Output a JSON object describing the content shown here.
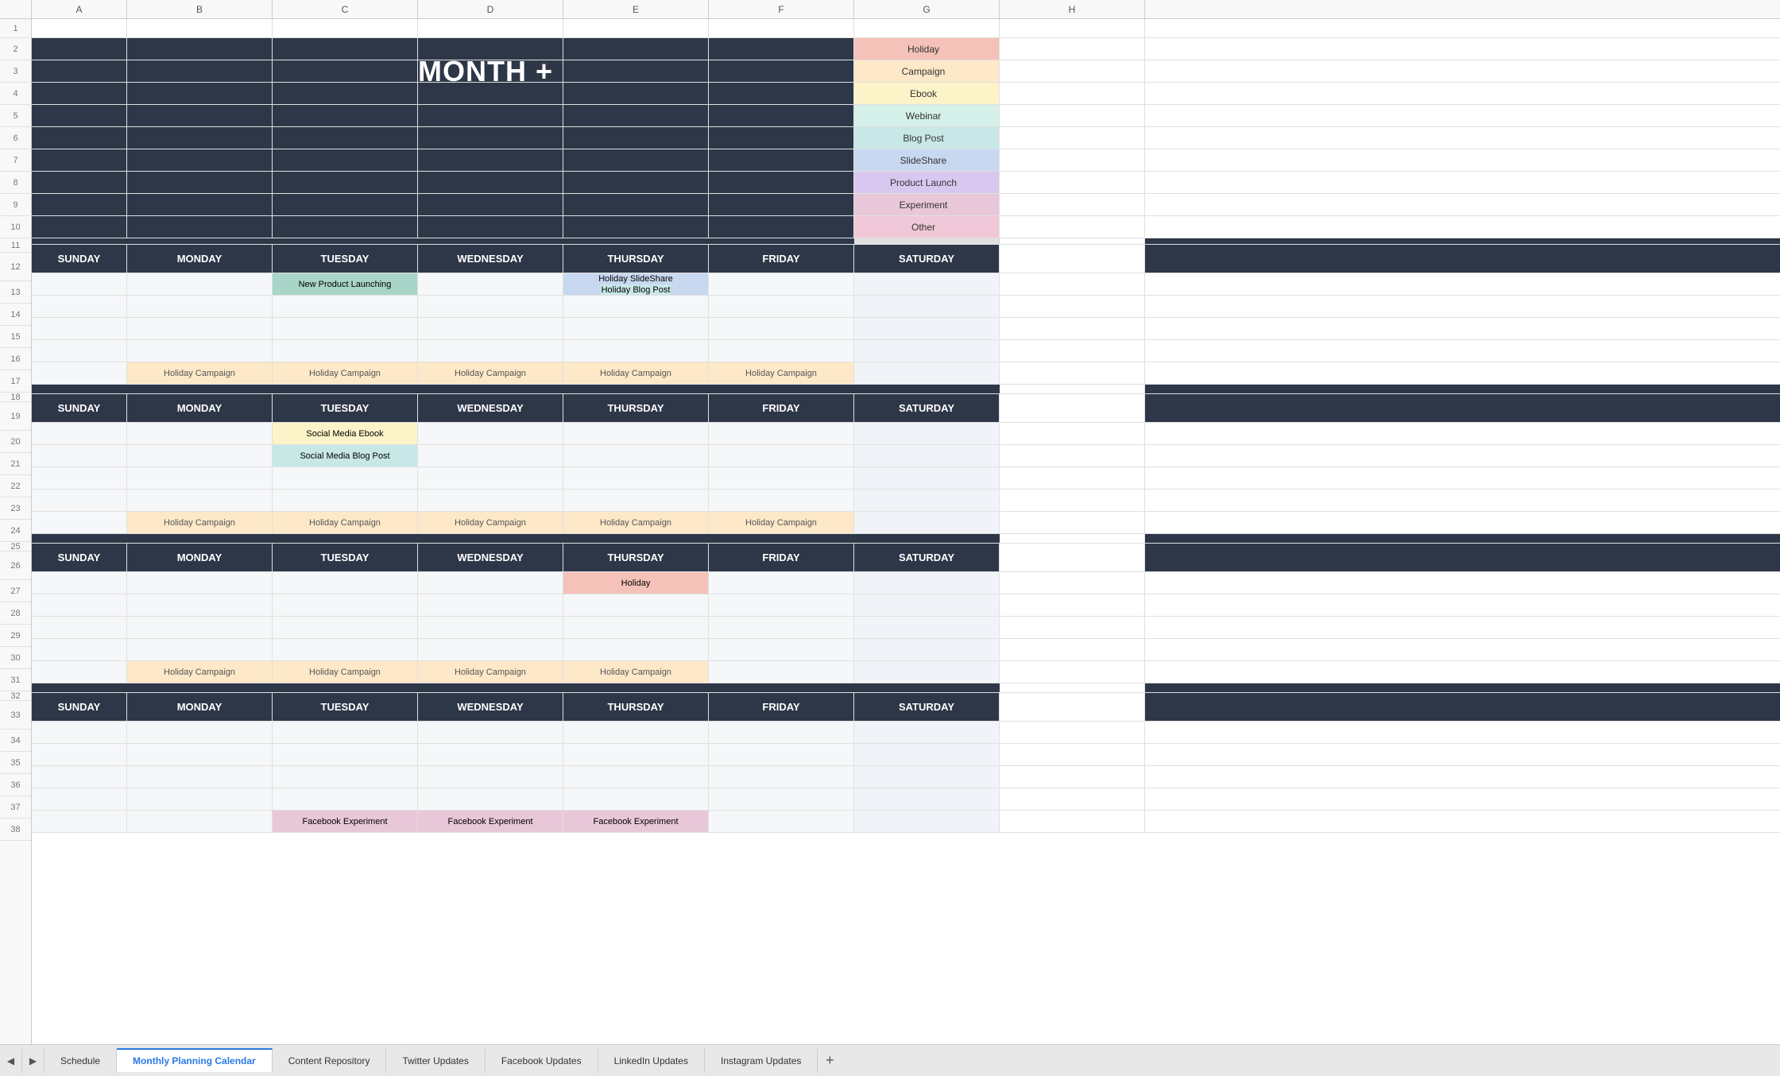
{
  "colHeaders": [
    "A",
    "B",
    "C",
    "D",
    "E",
    "F",
    "G",
    "H"
  ],
  "title": "[INSERT MONTH + YEAR]",
  "legend": {
    "items": [
      {
        "label": "Holiday",
        "colorClass": "legend-holiday"
      },
      {
        "label": "Campaign",
        "colorClass": "legend-campaign"
      },
      {
        "label": "Ebook",
        "colorClass": "legend-ebook"
      },
      {
        "label": "Webinar",
        "colorClass": "legend-webinar"
      },
      {
        "label": "Blog Post",
        "colorClass": "legend-blogpost"
      },
      {
        "label": "SlideShare",
        "colorClass": "legend-slideshare"
      },
      {
        "label": "Product Launch",
        "colorClass": "legend-productlaunch"
      },
      {
        "label": "Experiment",
        "colorClass": "legend-experiment"
      },
      {
        "label": "Other",
        "colorClass": "legend-other"
      }
    ]
  },
  "days": [
    "SUNDAY",
    "MONDAY",
    "TUESDAY",
    "WEDNESDAY",
    "THURSDAY",
    "FRIDAY",
    "SATURDAY"
  ],
  "week1": {
    "row13": {
      "tuesday": "New Product Launching",
      "thursday_top": "Holiday SlideShare",
      "thursday_bottom": "Holiday Blog Post"
    },
    "row17": {
      "monday": "Holiday Campaign",
      "tuesday": "Holiday Campaign",
      "wednesday": "Holiday Campaign",
      "thursday": "Holiday Campaign",
      "friday": "Holiday Campaign"
    }
  },
  "week2": {
    "row20_21": {
      "tuesday_top": "Social Media Ebook",
      "tuesday_bottom": "Social Media Blog Post"
    },
    "row24": {
      "monday": "Holiday Campaign",
      "tuesday": "Holiday Campaign",
      "wednesday": "Holiday Campaign",
      "thursday": "Holiday Campaign",
      "friday": "Holiday Campaign"
    }
  },
  "week3": {
    "row27": {
      "thursday": "Holiday"
    },
    "row31": {
      "monday": "Holiday Campaign",
      "tuesday": "Holiday Campaign",
      "wednesday": "Holiday Campaign",
      "thursday": "Holiday Campaign"
    }
  },
  "week4": {
    "row38": {
      "tuesday": "Facebook Experiment",
      "wednesday": "Facebook Experiment",
      "thursday": "Facebook Experiment"
    }
  },
  "tabs": [
    {
      "label": "Schedule",
      "active": false
    },
    {
      "label": "Monthly Planning Calendar",
      "active": true
    },
    {
      "label": "Content Repository",
      "active": false
    },
    {
      "label": "Twitter Updates",
      "active": false
    },
    {
      "label": "Facebook Updates",
      "active": false
    },
    {
      "label": "LinkedIn Updates",
      "active": false
    },
    {
      "label": "Instagram Updates",
      "active": false
    }
  ]
}
